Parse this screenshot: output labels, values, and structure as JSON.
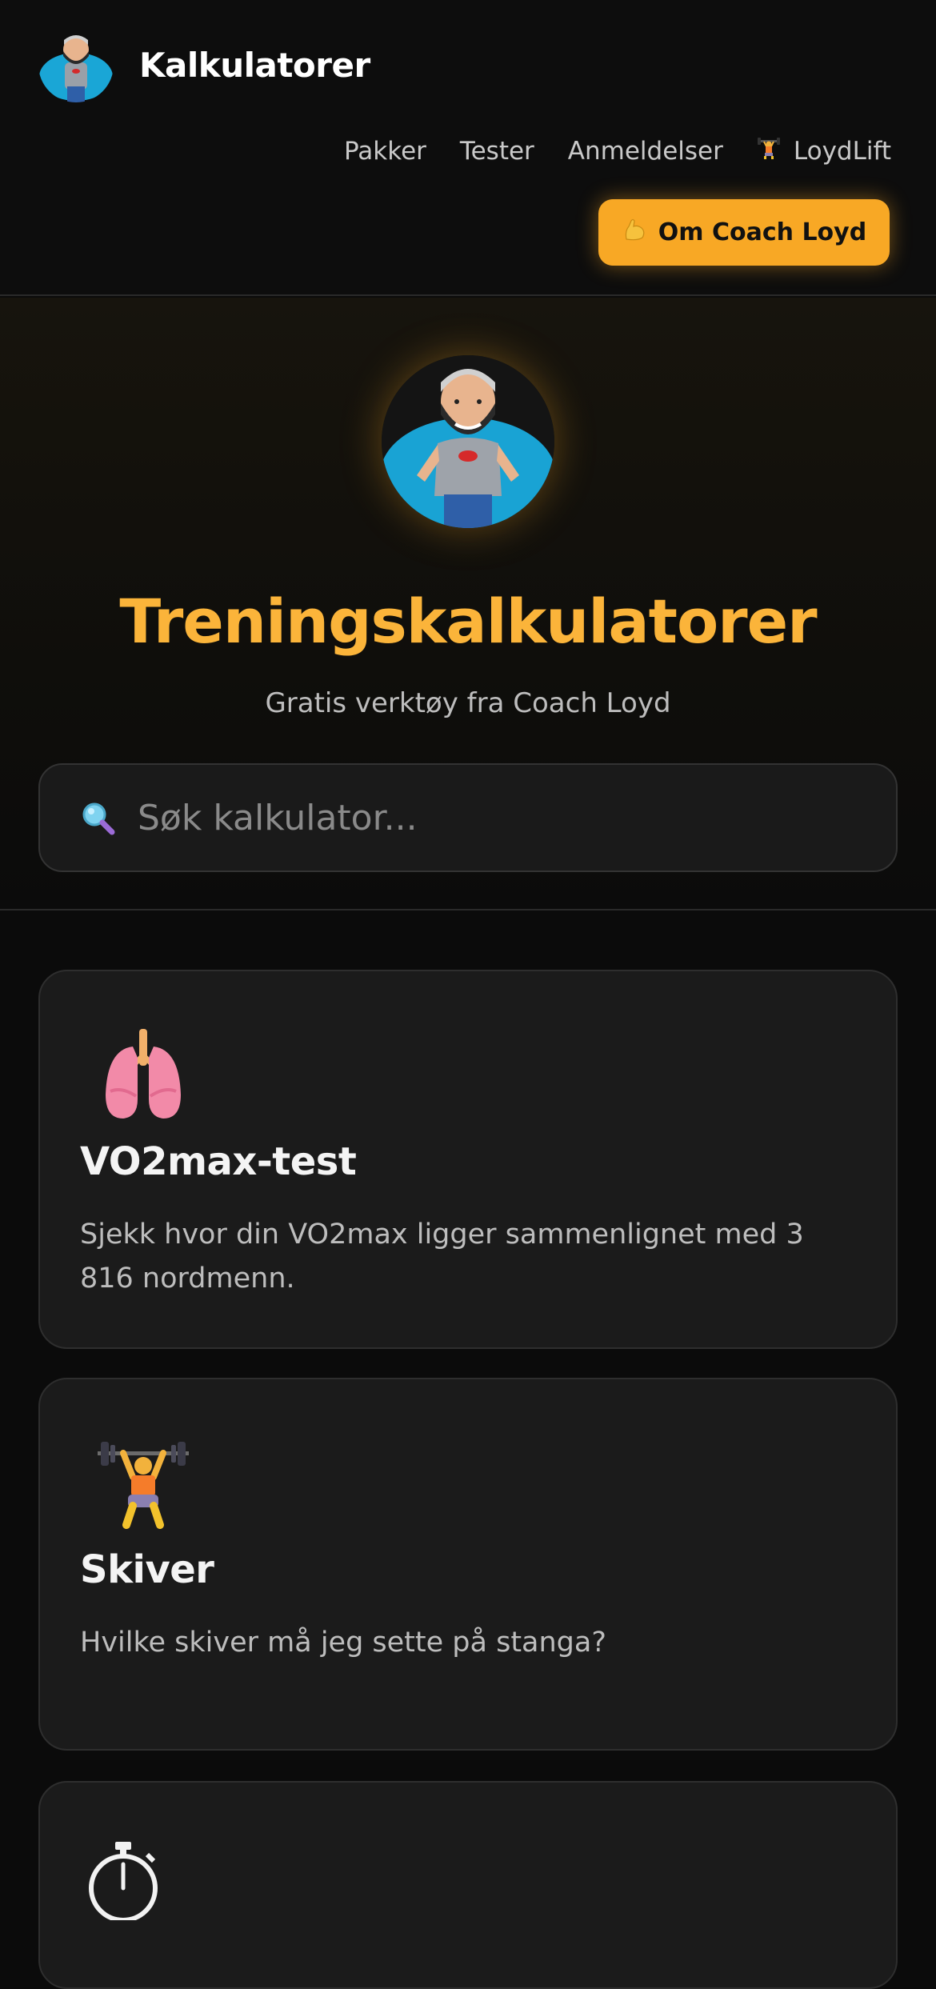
{
  "header": {
    "title": "Kalkulatorer",
    "nav": [
      {
        "label": "Pakker"
      },
      {
        "label": "Tester"
      },
      {
        "label": "Anmeldelser"
      },
      {
        "label": "LoydLift",
        "icon": "weightlifter-icon"
      }
    ],
    "cta_label": "Om Coach Loyd",
    "cta_icon": "flexed-biceps-icon"
  },
  "hero": {
    "title": "Treningskalkulatorer",
    "subtitle": "Gratis verktøy fra Coach Loyd"
  },
  "search": {
    "placeholder": "Søk kalkulator...",
    "icon": "magnifying-glass-icon"
  },
  "cards": [
    {
      "icon": "lungs-icon",
      "title": "VO2max-test",
      "description": "Sjekk hvor din VO2max ligger sammenlignet med 3 816 nordmenn."
    },
    {
      "icon": "weightlifter-icon",
      "title": "Skiver",
      "description": "Hvilke skiver må jeg sette på stanga?"
    },
    {
      "icon": "stopwatch-icon",
      "title": "",
      "description": ""
    }
  ],
  "colors": {
    "accent": "#f8a825",
    "hero_title": "#fbb43a",
    "background": "#0b0b0b",
    "card": "#1b1b1b"
  }
}
